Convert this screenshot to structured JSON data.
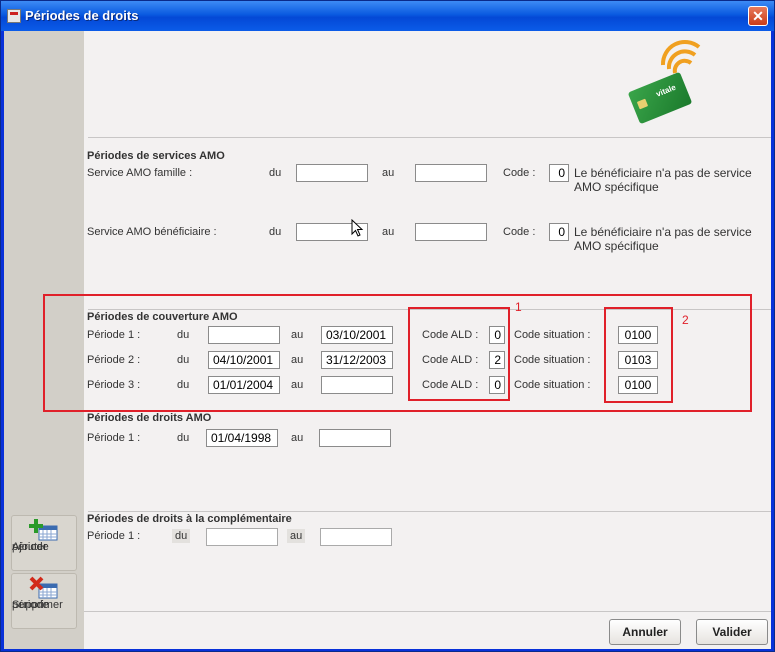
{
  "window": {
    "title": "Périodes de droits",
    "close": "✕"
  },
  "sidebar": {
    "add_label_1": "Ajouter",
    "add_label_2": "période",
    "del_label_1": "Supprimer",
    "del_label_2": "période"
  },
  "header": {
    "card_text": "vitale"
  },
  "services": {
    "title": "Périodes de services AMO",
    "famille": {
      "label": "Service AMO famille :",
      "du": "du",
      "au": "au",
      "du_value": "",
      "au_value": "",
      "code_label": "Code :",
      "code": "0",
      "desc1": "Le bénéficiaire n'a pas de service",
      "desc2": "AMO spécifique"
    },
    "beneficiaire": {
      "label": "Service AMO bénéficiaire :",
      "du": "du",
      "au": "au",
      "du_value": "",
      "au_value": "",
      "code_label": "Code :",
      "code": "0",
      "desc1": "Le bénéficiaire n'a pas de service",
      "desc2": "AMO spécifique"
    }
  },
  "couverture": {
    "title": "Périodes de couverture AMO",
    "rows": [
      {
        "label": "Période 1 :",
        "du": "du",
        "du_value": "",
        "au": "au",
        "au_value": "03/10/2001",
        "ald_label": "Code ALD :",
        "ald": "0",
        "sit_label": "Code situation :",
        "sit": "0100"
      },
      {
        "label": "Période 2 :",
        "du": "du",
        "du_value": "04/10/2001",
        "au": "au",
        "au_value": "31/12/2003",
        "ald_label": "Code ALD :",
        "ald": "2",
        "sit_label": "Code situation :",
        "sit": "0103"
      },
      {
        "label": "Période 3 :",
        "du": "du",
        "du_value": "01/01/2004",
        "au": "au",
        "au_value": "",
        "ald_label": "Code ALD :",
        "ald": "0",
        "sit_label": "Code situation :",
        "sit": "0100"
      }
    ],
    "marker1": "1",
    "marker2": "2"
  },
  "droits": {
    "title": "Périodes de droits AMO",
    "row": {
      "label": "Période 1 :",
      "du": "du",
      "du_value": "01/04/1998",
      "au": "au",
      "au_value": ""
    }
  },
  "complementaire": {
    "title": "Périodes de droits à la complémentaire",
    "row": {
      "label": "Période 1 :",
      "du": "du",
      "du_value": "",
      "au": "au",
      "au_value": ""
    }
  },
  "footer": {
    "cancel": "Annuler",
    "validate": "Valider"
  },
  "colors": {
    "titlebar": "#0a5ae0",
    "highlight": "#e0202a",
    "sidebar": "#d2cfc8"
  }
}
